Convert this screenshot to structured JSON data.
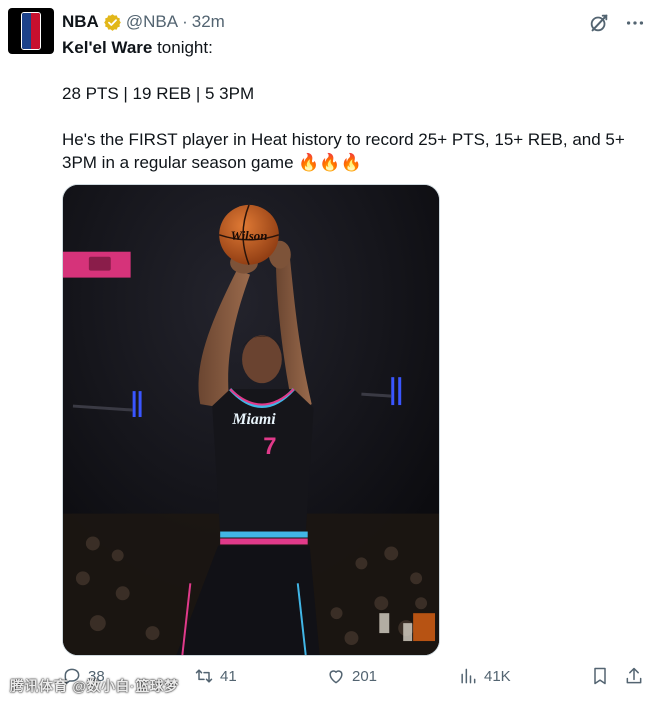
{
  "post": {
    "author": {
      "display_name": "NBA",
      "handle": "@NBA",
      "separator": "·",
      "time": "32m",
      "verified": true,
      "avatar_icon": "nba-logo-icon"
    },
    "text": {
      "line1_mention": "Kel'el Ware",
      "line1_rest": " tonight:",
      "stats": "28 PTS | 19 REB | 5 3PM",
      "body": "He's the FIRST player in Heat history to record 25+ PTS, 15+ REB, and 5+ 3PM in a regular season game",
      "emoji": "🔥🔥🔥"
    },
    "media": {
      "ball_brand": "Wilson",
      "jersey_script": "Miami",
      "jersey_number": "7"
    },
    "actions": {
      "replies": "38",
      "reposts": "41",
      "likes": "201",
      "views": "41K"
    }
  },
  "watermark": "腾讯体育 @数小白·篮球梦",
  "colors": {
    "text_primary": "#0f1419",
    "text_secondary": "#536471",
    "verified_gold": "#e2b719",
    "heat_pink": "#e03a8a",
    "heat_blue": "#41b6e6"
  }
}
